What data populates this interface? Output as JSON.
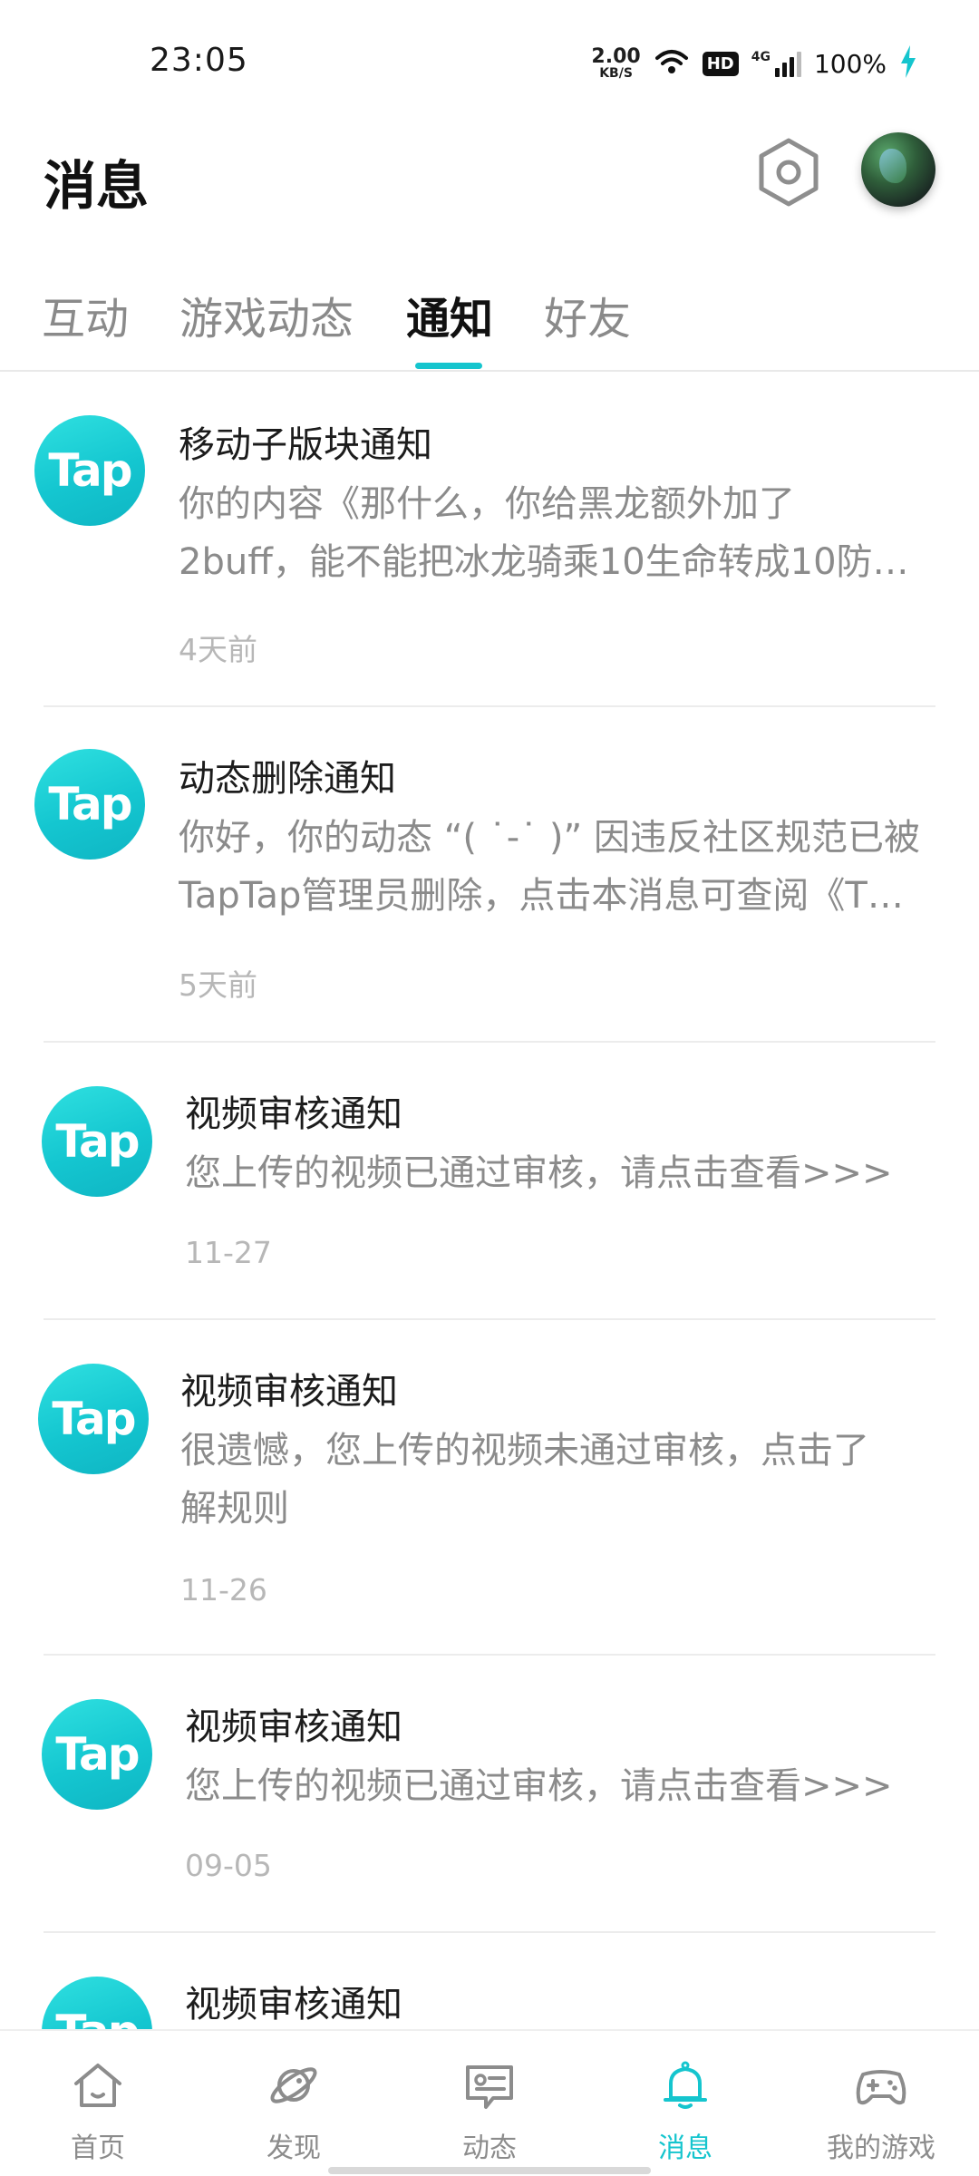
{
  "status_bar": {
    "time": "23:05",
    "net_speed_value": "2.00",
    "net_speed_unit": "KB/S",
    "hd": "HD",
    "network_type": "4G",
    "battery": "100%"
  },
  "header": {
    "title": "消息",
    "settings_icon": "settings-hexagon-icon",
    "avatar_icon": "user-avatar"
  },
  "tabs": [
    {
      "label": "互动",
      "active": false
    },
    {
      "label": "游戏动态",
      "active": false
    },
    {
      "label": "通知",
      "active": true
    },
    {
      "label": "好友",
      "active": false
    }
  ],
  "accent_color": "#15c5ce",
  "notifications": [
    {
      "logo": "Tap",
      "title": "移动子版块通知",
      "body_lines": [
        "你的内容《那什么，你给黑龙额外加了",
        "2buff，能不能把冰龙骑乘10生命转成10防…"
      ],
      "time": "4天前"
    },
    {
      "logo": "Tap",
      "title": "动态删除通知",
      "body_lines": [
        "你好，你的动态 “( ˙-˙ )” 因违反社区规范已被",
        "TapTap管理员删除，点击本消息可查阅《T…"
      ],
      "time": "5天前"
    },
    {
      "logo": "Tap",
      "title": "视频审核通知",
      "body_lines": [
        "您上传的视频已通过审核，请点击查看>>>"
      ],
      "time": "11-27"
    },
    {
      "logo": "Tap",
      "title": "视频审核通知",
      "body_lines": [
        "很遗憾，您上传的视频未通过审核，点击了",
        "解规则"
      ],
      "time": "11-26"
    },
    {
      "logo": "Tap",
      "title": "视频审核通知",
      "body_lines": [
        "您上传的视频已通过审核，请点击查看>>>"
      ],
      "time": "09-05"
    },
    {
      "logo": "Tap",
      "title": "视频审核通知",
      "body_lines": [],
      "time": ""
    }
  ],
  "bottom_nav": [
    {
      "label": "首页",
      "icon": "home-icon",
      "active": false
    },
    {
      "label": "发现",
      "icon": "planet-icon",
      "active": false
    },
    {
      "label": "动态",
      "icon": "chat-card-icon",
      "active": false
    },
    {
      "label": "消息",
      "icon": "bell-icon",
      "active": true
    },
    {
      "label": "我的游戏",
      "icon": "gamepad-icon",
      "active": false
    }
  ]
}
